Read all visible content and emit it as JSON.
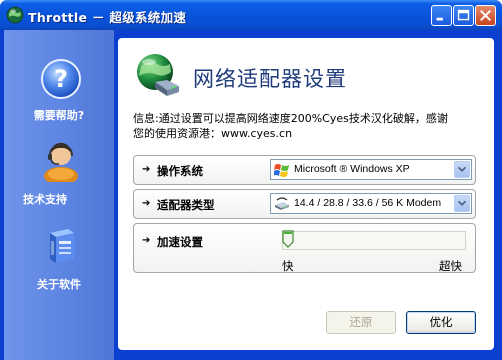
{
  "window": {
    "title": "Throttle － 超级系统加速"
  },
  "sidebar": {
    "items": [
      {
        "label": "需要帮助?",
        "icon": "help-icon"
      },
      {
        "label": "技术支持",
        "icon": "support-person-icon"
      },
      {
        "label": "关于软件",
        "icon": "about-box-icon"
      }
    ]
  },
  "main": {
    "heading": "网络适配器设置",
    "heading_icon": "network-globe-icon",
    "info_line1": "信息:通过设置可以提高网络速度200%Cyes技术汉化破解，感谢",
    "info_line2": "您的使用资源港：www.cyes.cn",
    "os_row": {
      "label": "操作系统",
      "value": "Microsoft ® Windows XP",
      "icon": "windows-logo-icon"
    },
    "adapter_row": {
      "label": "适配器类型",
      "value": "14.4 / 28.8 / 33.6 / 56 K Modem",
      "icon": "modem-icon"
    },
    "speed_row": {
      "label": "加速设置",
      "slider_level": 0,
      "min_label": "快",
      "max_label": "超快"
    },
    "buttons": {
      "restore_label": "还原",
      "optimize_label": "优化"
    }
  },
  "colors": {
    "titlebar": "#0854dc",
    "sidebar": "#5b83e1",
    "frame": "#0a3fcf",
    "heading": "#1f3a7a"
  }
}
